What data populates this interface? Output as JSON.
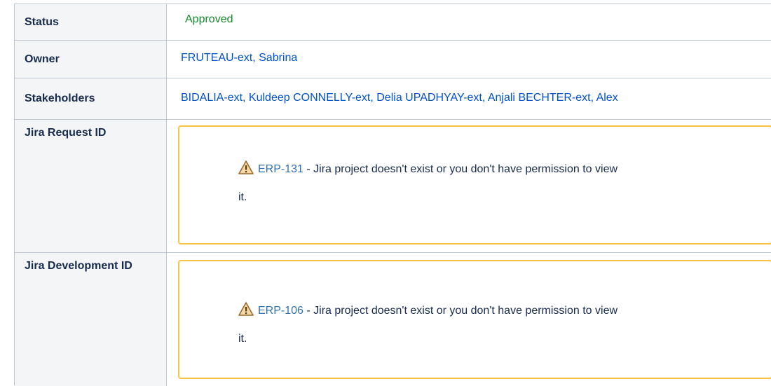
{
  "rows": {
    "status": {
      "label": "Status",
      "value": "Approved",
      "color": "#14892c"
    },
    "owner": {
      "label": "Owner",
      "value": "FRUTEAU-ext, Sabrina"
    },
    "stakeholders": {
      "label": "Stakeholders",
      "people": [
        "BIDALIA-ext, Kuldeep",
        "CONNELLY-ext, Delia",
        "UPADHYAY-ext, Anjali",
        "BECHTER-ext, Alex"
      ]
    },
    "jira_request": {
      "label": "Jira Request ID",
      "issue_key": "ERP-131",
      "message": " - Jira project doesn't exist or you don't have permission to view",
      "message_end": "it.",
      "icon": "warning-icon"
    },
    "jira_development": {
      "label": "Jira Development ID",
      "issue_key": "ERP-106",
      "message": " - Jira project doesn't exist or you don't have permission to view",
      "message_end": "it.",
      "icon": "warning-icon"
    }
  },
  "colors": {
    "link": "#0052cc",
    "warning_border": "#f6c342",
    "header_bg": "#f4f5f7"
  }
}
